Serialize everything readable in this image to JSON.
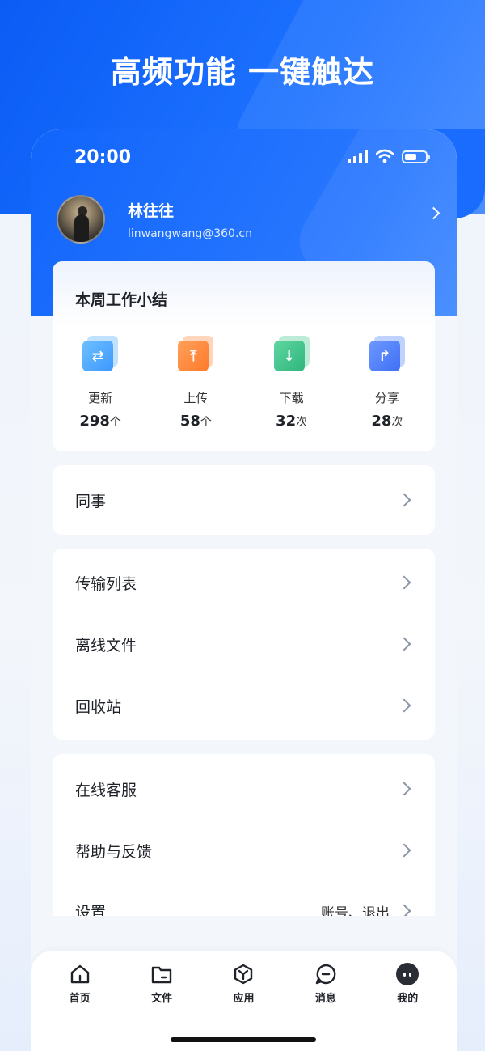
{
  "hero": {
    "title": "高频功能 一键触达"
  },
  "status_bar": {
    "time": "20:00"
  },
  "profile": {
    "name": "林往往",
    "email": "linwangwang@360.cn"
  },
  "summary": {
    "title": "本周工作小结",
    "stats": [
      {
        "label": "更新",
        "value": "298",
        "unit": "个",
        "icon": "sync-icon",
        "color": "#4aa8ff"
      },
      {
        "label": "上传",
        "value": "58",
        "unit": "个",
        "icon": "upload-icon",
        "color": "#ff8a3d"
      },
      {
        "label": "下载",
        "value": "32",
        "unit": "次",
        "icon": "download-icon",
        "color": "#3ec58e"
      },
      {
        "label": "分享",
        "value": "28",
        "unit": "次",
        "icon": "share-icon",
        "color": "#4a7dff"
      }
    ]
  },
  "menu": {
    "colleagues": "同事",
    "transfer_list": "传输列表",
    "offline_files": "离线文件",
    "recycle_bin": "回收站",
    "online_service": "在线客服",
    "help_feedback": "帮助与反馈",
    "settings": "设置",
    "settings_extra": "账号、退出"
  },
  "tabbar": {
    "home": "首页",
    "files": "文件",
    "apps": "应用",
    "messages": "消息",
    "mine": "我的"
  }
}
